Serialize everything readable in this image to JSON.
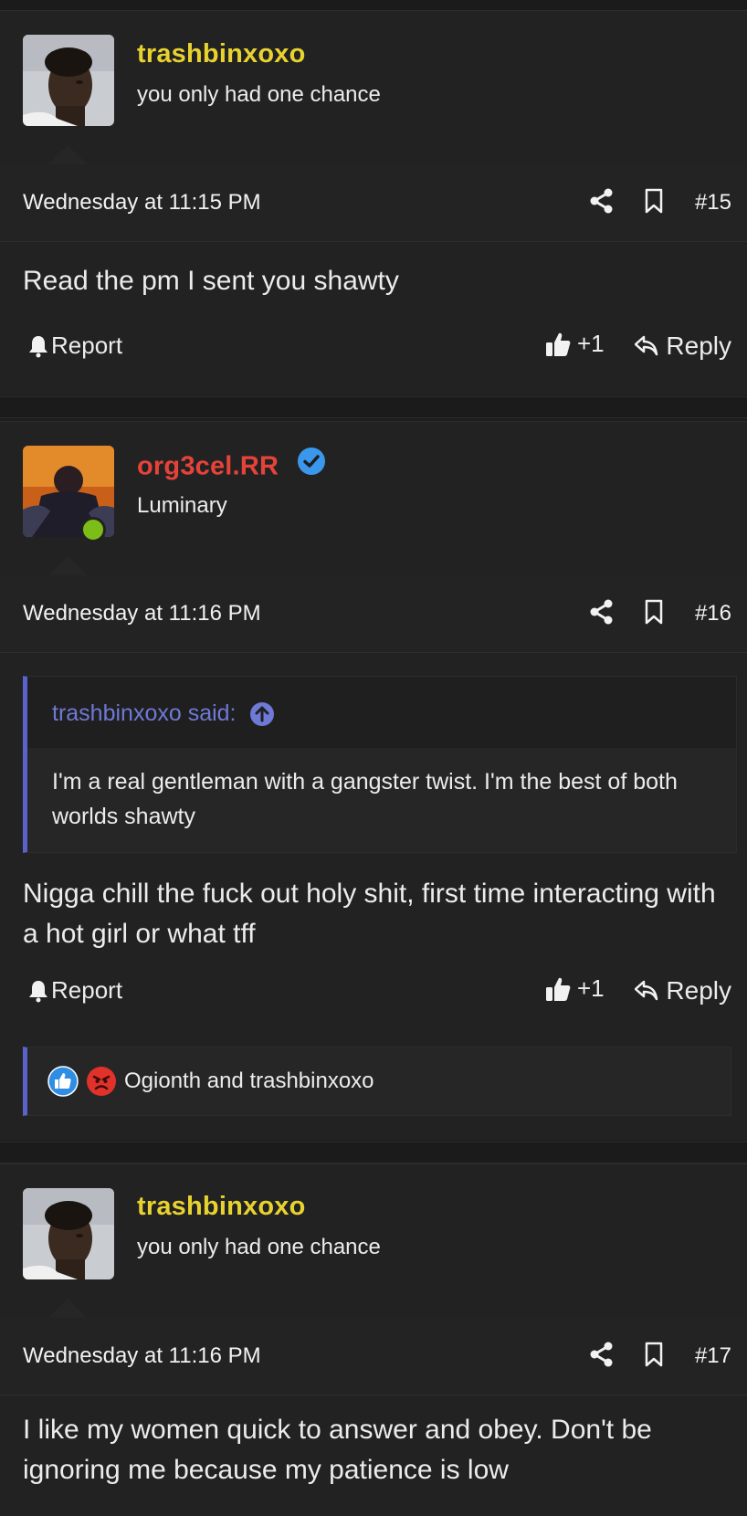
{
  "colors": {
    "username_gold": "#e8d22f",
    "username_red": "#e5433a",
    "quote_accent": "#5a63c9",
    "online": "#7cbd17",
    "verified": "#3a97ec"
  },
  "posts": [
    {
      "username": "trashbinxoxo",
      "user_title": "you only had one chance",
      "date": "Wednesday at 11:15 PM",
      "post_number": "#15",
      "body": "Read the pm I sent you shawty",
      "report_label": "Report",
      "like_count": "+1",
      "reply_label": "Reply"
    },
    {
      "username": "org3cel.RR",
      "user_title": "Luminary",
      "date": "Wednesday at 11:16 PM",
      "post_number": "#16",
      "quote": {
        "author": "trashbinxoxo said:",
        "text": "I'm a real gentleman with a gangster twist. I'm the best of both worlds shawty"
      },
      "body": "Nigga chill the fuck out holy shit, first time interacting with a hot girl or what tff",
      "report_label": "Report",
      "like_count": "+1",
      "reply_label": "Reply",
      "reactions_text": "Ogionth and trashbinxoxo"
    },
    {
      "username": "trashbinxoxo",
      "user_title": "you only had one chance",
      "date": "Wednesday at 11:16 PM",
      "post_number": "#17",
      "body": "I like my women quick to answer and obey. Don't be ignoring me because my patience is low"
    }
  ]
}
